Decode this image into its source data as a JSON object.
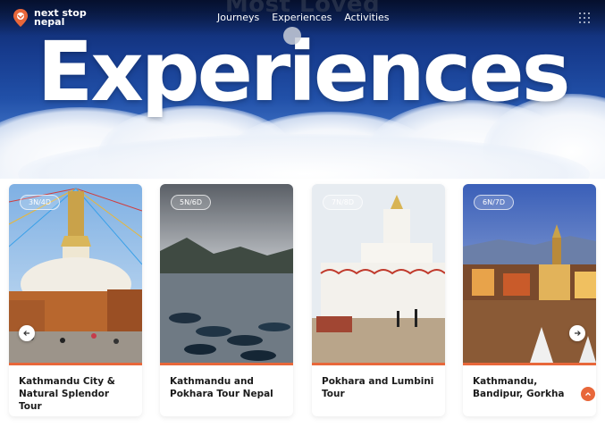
{
  "brand": {
    "line1": "next stop",
    "line2": "nepal",
    "accent_color": "#e8673a"
  },
  "nav": {
    "items": [
      "Journeys",
      "Experiences",
      "Activities"
    ]
  },
  "hero": {
    "ghost_title": "Most Loved",
    "title": "Experiences"
  },
  "cards": [
    {
      "duration": "3N/4D",
      "title": "Kathmandu City & Natural Splendor Tour"
    },
    {
      "duration": "5N/6D",
      "title": "Kathmandu and Pokhara Tour Nepal"
    },
    {
      "duration": "7N/8D",
      "title": "Pokhara and Lumbini Tour"
    },
    {
      "duration": "6N/7D",
      "title": "Kathmandu, Bandipur, Gorkha"
    }
  ],
  "icons": {
    "logo": "map-pin-icon",
    "menu": "grid-menu-icon",
    "prev": "arrow-left-icon",
    "next": "arrow-right-icon",
    "scroll_top": "chevron-up-icon"
  }
}
